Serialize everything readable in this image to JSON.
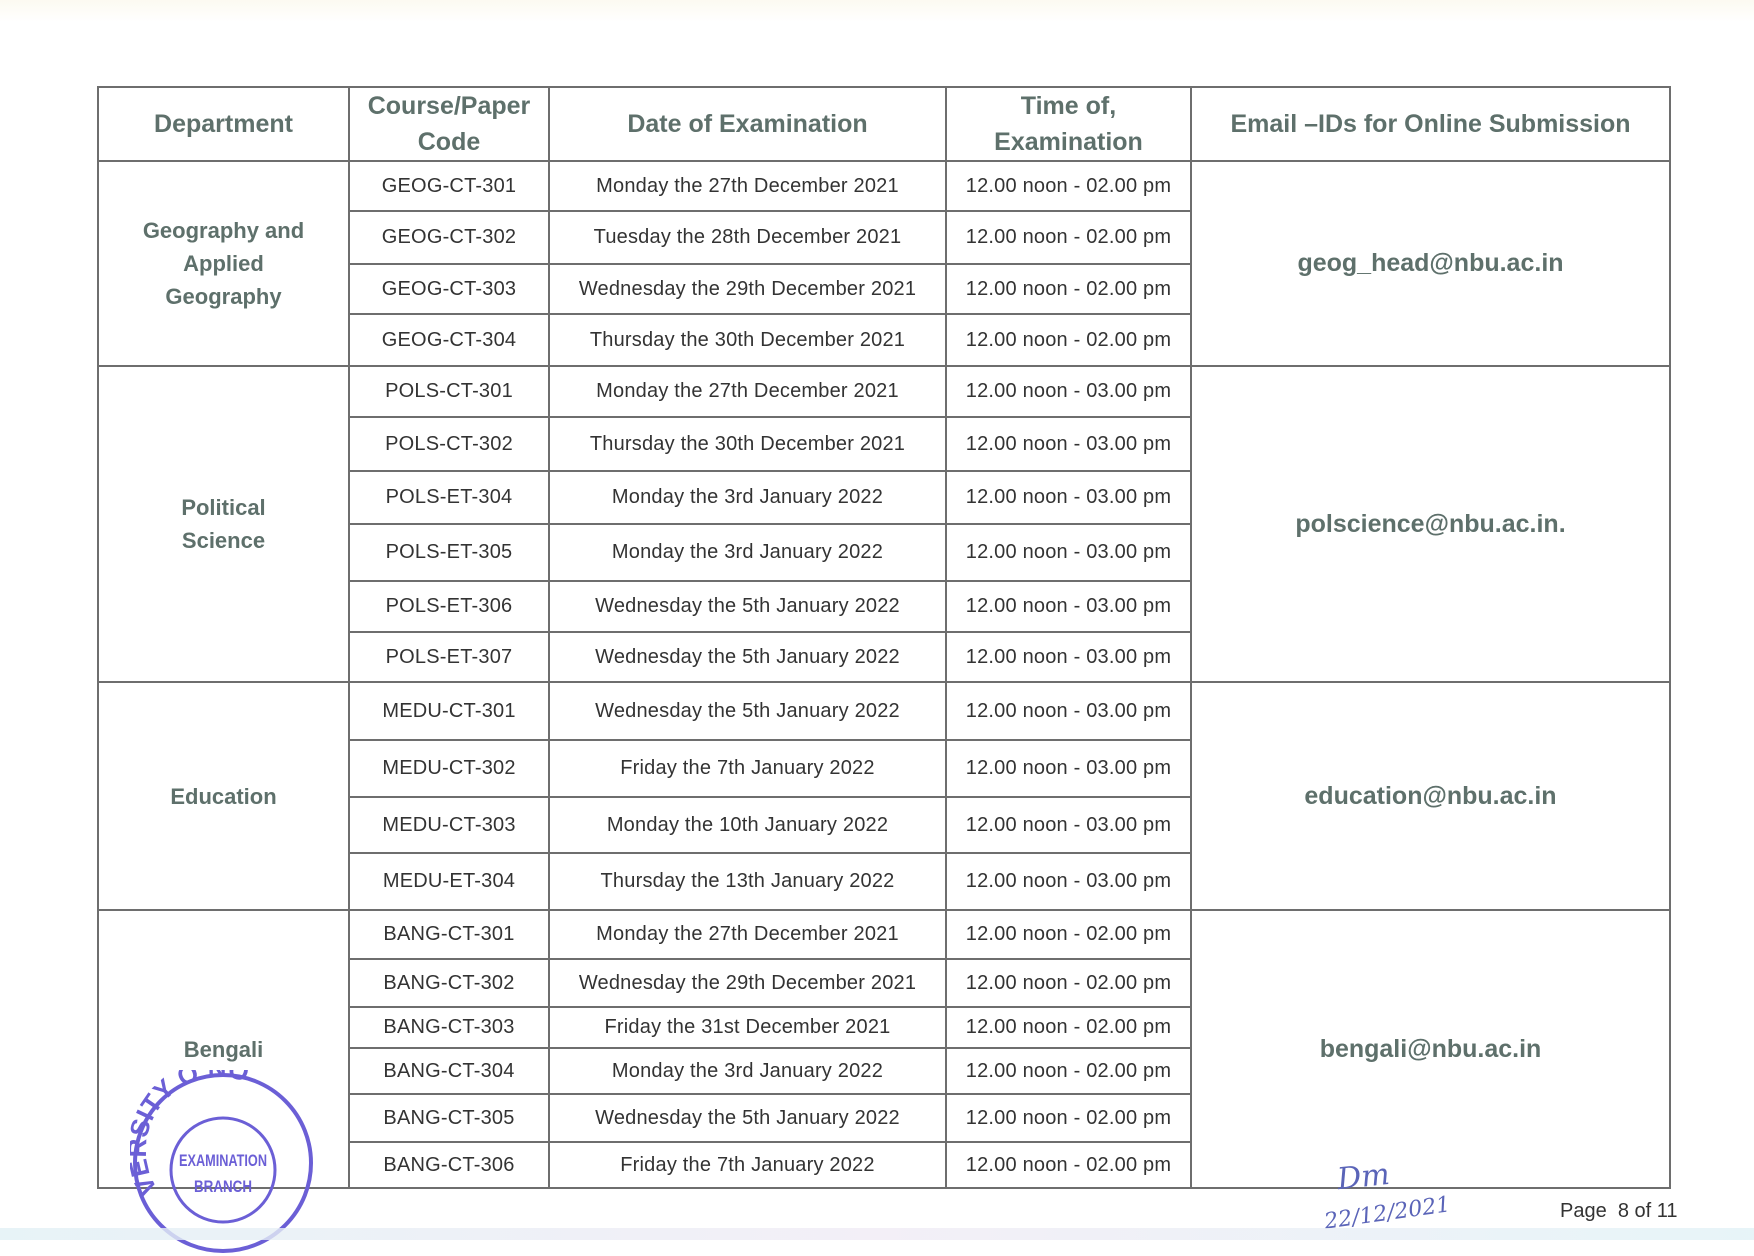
{
  "table": {
    "headers": {
      "department": "Department",
      "course_code": "Course/Paper Code",
      "date": "Date of Examination",
      "time": "Time of, Examination",
      "email": "Email –IDs for Online Submission"
    },
    "departments": [
      {
        "name": "Geography and Applied Geography",
        "email": "geog_head@nbu.ac.in",
        "rows": [
          {
            "code": "GEOG-CT-301",
            "date": "Monday the 27th December 2021",
            "time": "12.00 noon - 02.00 pm"
          },
          {
            "code": "GEOG-CT-302",
            "date": "Tuesday the 28th December 2021",
            "time": "12.00 noon - 02.00 pm"
          },
          {
            "code": "GEOG-CT-303",
            "date": "Wednesday the 29th December 2021",
            "time": "12.00 noon - 02.00 pm"
          },
          {
            "code": "GEOG-CT-304",
            "date": "Thursday the 30th December 2021",
            "time": "12.00 noon - 02.00 pm"
          }
        ]
      },
      {
        "name": "Political Science",
        "email": "polscience@nbu.ac.in.",
        "rows": [
          {
            "code": "POLS-CT-301",
            "date": "Monday the 27th December 2021",
            "time": "12.00 noon - 03.00 pm"
          },
          {
            "code": "POLS-CT-302",
            "date": "Thursday the 30th December 2021",
            "time": "12.00 noon - 03.00 pm"
          },
          {
            "code": "POLS-ET-304",
            "date": "Monday the 3rd January 2022",
            "time": "12.00 noon - 03.00 pm"
          },
          {
            "code": "POLS-ET-305",
            "date": "Monday the 3rd January 2022",
            "time": "12.00 noon - 03.00 pm"
          },
          {
            "code": "POLS-ET-306",
            "date": "Wednesday the 5th January 2022",
            "time": "12.00 noon - 03.00 pm"
          },
          {
            "code": "POLS-ET-307",
            "date": "Wednesday the 5th January 2022",
            "time": "12.00 noon - 03.00 pm"
          }
        ]
      },
      {
        "name": "Education",
        "email": "education@nbu.ac.in",
        "rows": [
          {
            "code": "MEDU-CT-301",
            "date": "Wednesday the 5th January 2022",
            "time": "12.00 noon - 03.00 pm"
          },
          {
            "code": "MEDU-CT-302",
            "date": "Friday the 7th January 2022",
            "time": "12.00 noon - 03.00 pm"
          },
          {
            "code": "MEDU-CT-303",
            "date": "Monday the 10th January 2022",
            "time": "12.00 noon - 03.00 pm"
          },
          {
            "code": "MEDU-ET-304",
            "date": "Thursday the 13th January 2022",
            "time": "12.00 noon - 03.00 pm"
          }
        ]
      },
      {
        "name": "Bengali",
        "email": "bengali@nbu.ac.in",
        "rows": [
          {
            "code": "BANG-CT-301",
            "date": "Monday the 27th December 2021",
            "time": "12.00 noon - 02.00 pm"
          },
          {
            "code": "BANG-CT-302",
            "date": "Wednesday the 29th December 2021",
            "time": "12.00 noon - 02.00 pm"
          },
          {
            "code": "BANG-CT-303",
            "date": "Friday the 31st December 2021",
            "time": "12.00 noon - 02.00 pm"
          },
          {
            "code": "BANG-CT-304",
            "date": "Monday the 3rd January 2022",
            "time": "12.00 noon - 02.00 pm"
          },
          {
            "code": "BANG-CT-305",
            "date": "Wednesday the 5th January 2022",
            "time": "12.00 noon - 02.00 pm"
          },
          {
            "code": "BANG-CT-306",
            "date": "Friday the 7th January 2022",
            "time": "12.00 noon - 02.00 pm"
          }
        ]
      }
    ]
  },
  "stamp": {
    "outer_text": "VERSITY O NO",
    "inner_line1": "EXAMINATION",
    "inner_line2": "BRANCH",
    "color": "#6b5fd6"
  },
  "signature": {
    "initials": "Dm",
    "date": "22/12/2021",
    "color": "#5a64b8"
  },
  "footer": {
    "page_label": "Page  8 of 11"
  },
  "colors": {
    "header_text": "#5e706b",
    "body_text": "#333333",
    "border": "#6e6e6e"
  }
}
